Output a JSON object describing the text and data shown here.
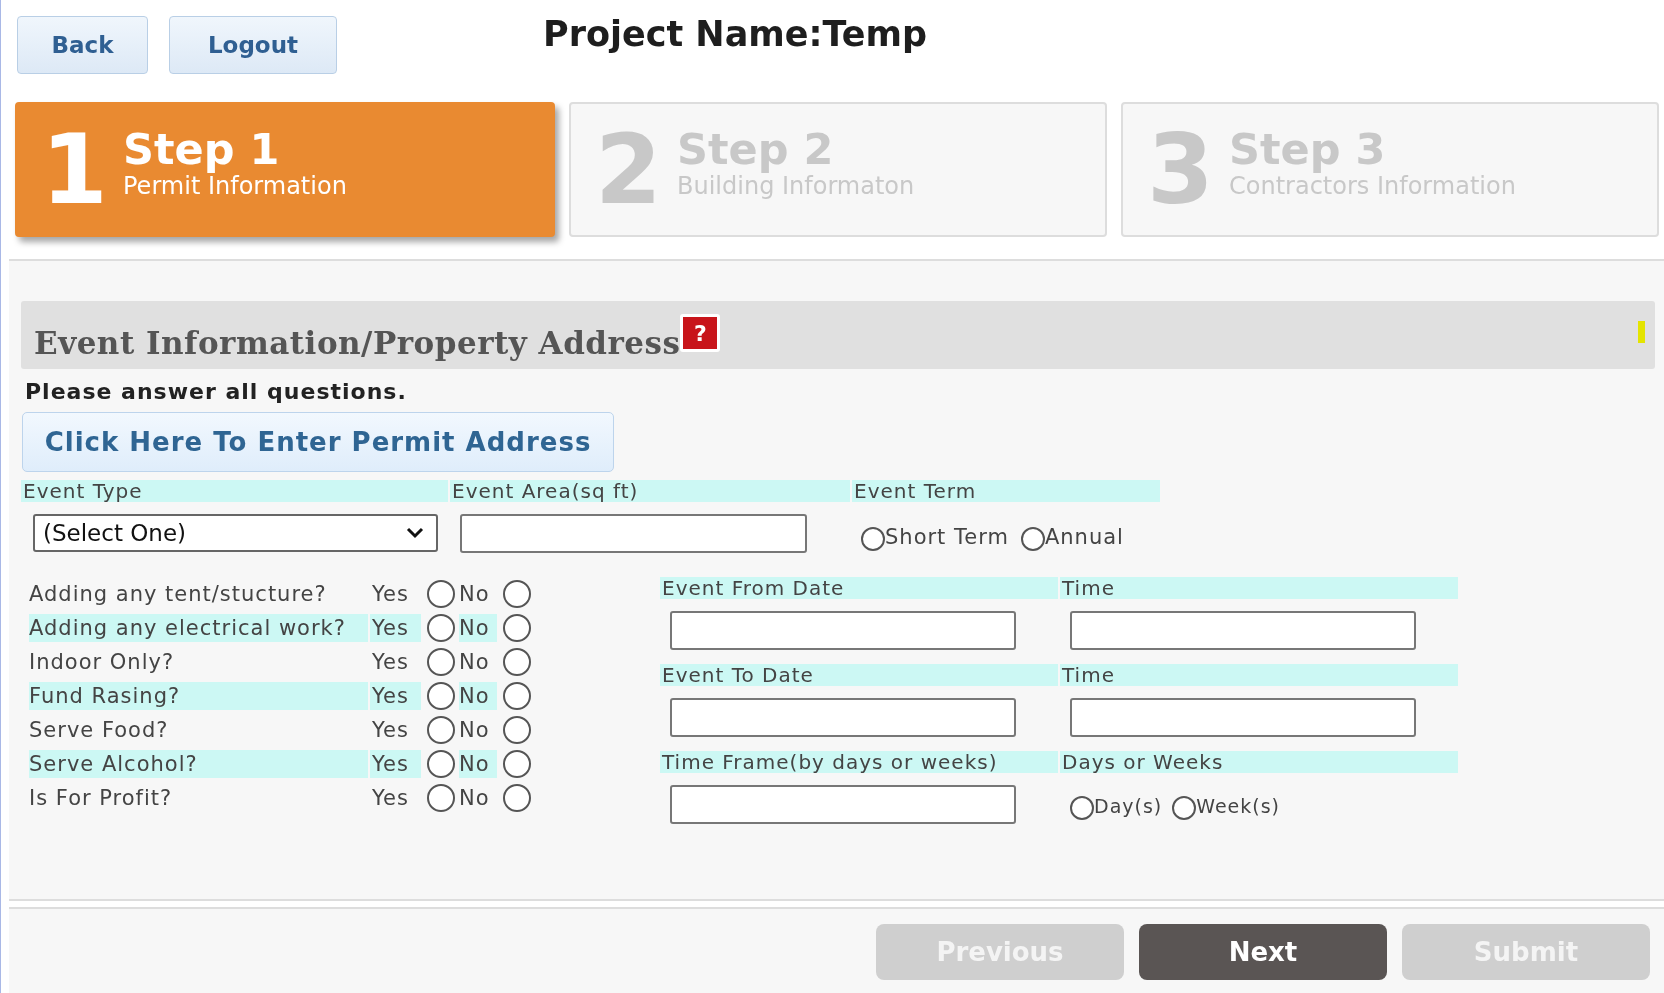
{
  "top_buttons": [
    {
      "label": "Back"
    },
    {
      "label": "Logout"
    }
  ],
  "title": "Project Name:Temp",
  "steps": [
    {
      "number": "1",
      "title": "Step 1",
      "subtitle": "Permit Information",
      "selected": true
    },
    {
      "number": "2",
      "title": "Step 2",
      "subtitle": "Building Informaton",
      "selected": false
    },
    {
      "number": "3",
      "title": "Step 3",
      "subtitle": "Contractors Information",
      "selected": false
    }
  ],
  "section": {
    "title": "Event Information/Property Address",
    "help": "?"
  },
  "instruction": "Please answer all questions.",
  "address_button": "Click Here To Enter Permit Address",
  "event_type": {
    "label": "Event Type",
    "value": "(Select One)"
  },
  "event_area": {
    "label": "Event Area(sq ft)"
  },
  "event_term": {
    "label": "Event Term",
    "options": [
      {
        "label": "Short Term",
        "selected": false
      },
      {
        "label": "Annual",
        "selected": false
      }
    ]
  },
  "questions": [
    {
      "label": "Adding any tent/stucture?",
      "highlighted": false,
      "yes": "Yes",
      "no": "No",
      "yes_selected": false,
      "no_selected": false
    },
    {
      "label": "Adding any electrical work?",
      "highlighted": true,
      "yes": "Yes",
      "no": "No",
      "yes_selected": false,
      "no_selected": false
    },
    {
      "label": "Indoor Only?",
      "highlighted": false,
      "yes": "Yes",
      "no": "No",
      "yes_selected": false,
      "no_selected": false
    },
    {
      "label": "Fund Rasing?",
      "highlighted": true,
      "yes": "Yes",
      "no": "No",
      "yes_selected": false,
      "no_selected": false
    },
    {
      "label": "Serve Food?",
      "highlighted": false,
      "yes": "Yes",
      "no": "No",
      "yes_selected": false,
      "no_selected": false
    },
    {
      "label": "Serve Alcohol?",
      "highlighted": true,
      "yes": "Yes",
      "no": "No",
      "yes_selected": false,
      "no_selected": false
    },
    {
      "label": "Is For Profit?",
      "highlighted": false,
      "yes": "Yes",
      "no": "No",
      "yes_selected": false,
      "no_selected": false
    }
  ],
  "date_fields": [
    {
      "label": "Event From Date",
      "time_label": "Time"
    },
    {
      "label": "Event To Date",
      "time_label": "Time"
    }
  ],
  "time_frame": {
    "label": "Time Frame(by days or weeks)",
    "unit_label": "Days or Weeks",
    "units": [
      {
        "label": "Day(s)",
        "selected": false
      },
      {
        "label": "Week(s)",
        "selected": false
      }
    ]
  },
  "footer_buttons": [
    {
      "label": "Previous",
      "disabled": true
    },
    {
      "label": "Next",
      "disabled": false
    },
    {
      "label": "Submit",
      "disabled": true
    }
  ]
}
